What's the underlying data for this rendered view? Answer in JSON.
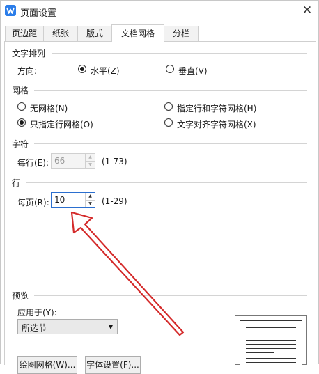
{
  "window": {
    "title": "页面设置",
    "close": "✕"
  },
  "tabs": [
    "页边距",
    "纸张",
    "版式",
    "文档网格",
    "分栏"
  ],
  "text_direction": {
    "group": "文字排列",
    "label": "方向:",
    "horizontal": "水平(Z)",
    "vertical": "垂直(V)"
  },
  "grid": {
    "group": "网格",
    "none": "无网格(N)",
    "char_and_line": "指定行和字符网格(H)",
    "line_only": "只指定行网格(O)",
    "align_chars": "文字对齐字符网格(X)"
  },
  "chars": {
    "group": "字符",
    "label": "每行(E):",
    "value": "66",
    "range": "(1-73)"
  },
  "lines": {
    "group": "行",
    "label": "每页(R):",
    "value": "10",
    "range": "(1-29)"
  },
  "preview": {
    "group": "预览",
    "apply_label": "应用于(Y):",
    "apply_value": "所选节"
  },
  "buttons": {
    "draw_grid": "绘图网格(W)...",
    "font_settings": "字体设置(F)..."
  },
  "colors": {
    "accent": "#2b7de9",
    "annotation_arrow": "#d42a2a"
  }
}
